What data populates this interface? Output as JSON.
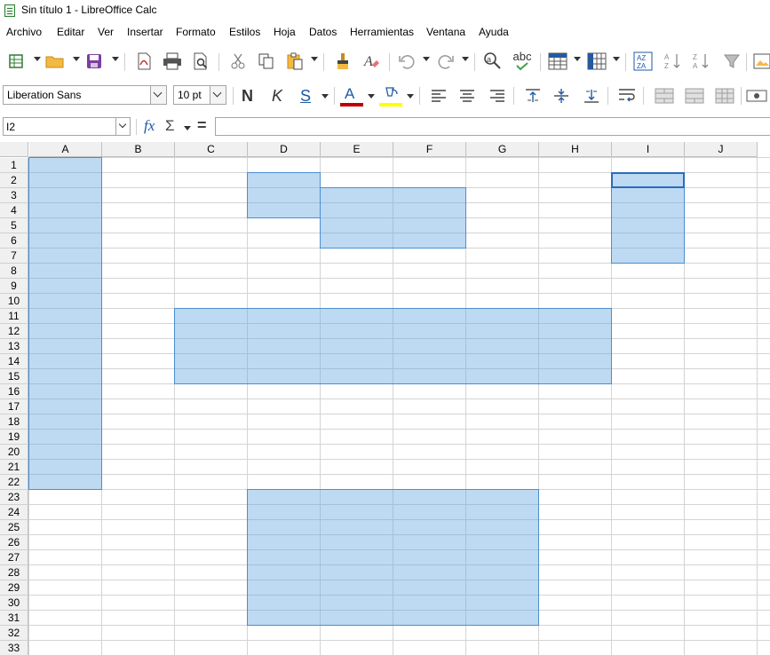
{
  "window": {
    "title": "Sin título 1 - LibreOffice Calc",
    "icon": "spreadsheet-icon"
  },
  "menubar": {
    "items": [
      "Archivo",
      "Editar",
      "Ver",
      "Insertar",
      "Formato",
      "Estilos",
      "Hoja",
      "Datos",
      "Herramientas",
      "Ventana",
      "Ayuda"
    ]
  },
  "toolbar_standard": {
    "icons": [
      "new-document-icon",
      "open-folder-icon",
      "save-icon",
      "export-pdf-icon",
      "print-icon",
      "print-preview-icon",
      "cut-icon",
      "copy-icon",
      "paste-icon",
      "clone-formatting-icon",
      "clear-formatting-icon",
      "undo-icon",
      "redo-icon",
      "find-replace-icon",
      "spellcheck-icon",
      "row-icon",
      "column-icon",
      "sort-icon",
      "sort-ascending-icon",
      "sort-descending-icon",
      "autofilter-icon",
      "image-icon"
    ],
    "spellcheck_text": "abc"
  },
  "toolbar_formatting": {
    "font_name": "Liberation Sans",
    "font_size": "10 pt",
    "bold_label": "N",
    "italic_label": "K",
    "underline_label": "S",
    "font_color_label": "A",
    "font_color": "#c00000",
    "highlight_color": "#ffff00"
  },
  "formula_bar": {
    "name_box": "I2",
    "function_wizard": "fx",
    "sum_symbol": "Σ",
    "equals_symbol": "=",
    "formula_value": ""
  },
  "sheet": {
    "columns": [
      "A",
      "B",
      "C",
      "D",
      "E",
      "F",
      "G",
      "H",
      "I",
      "J"
    ],
    "rows": [
      "1",
      "2",
      "3",
      "4",
      "5",
      "6",
      "7",
      "8",
      "9",
      "10",
      "11",
      "12",
      "13",
      "14",
      "15",
      "16",
      "17",
      "18",
      "19",
      "20",
      "21",
      "22",
      "23",
      "24",
      "25",
      "26",
      "27",
      "28",
      "29",
      "30",
      "31",
      "32",
      "33"
    ],
    "active_cell": "I2",
    "selected_ranges": [
      "A1:A22",
      "D2:D4",
      "E3:F6",
      "C11:H15",
      "D23:G31",
      "I2:I7"
    ],
    "selection_color": "#bfd9f2"
  }
}
